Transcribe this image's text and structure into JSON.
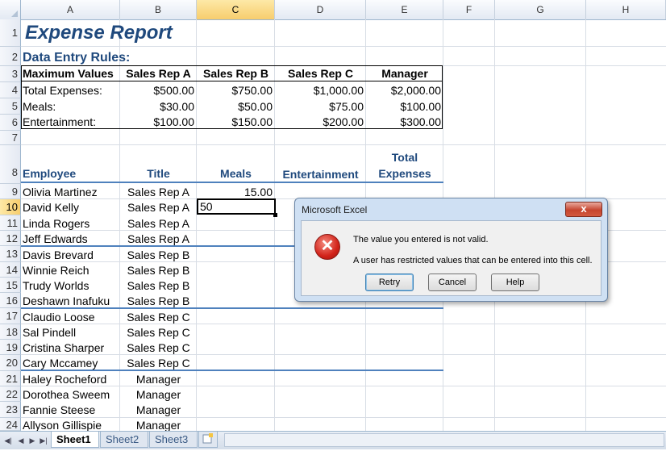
{
  "columns": [
    "A",
    "B",
    "C",
    "D",
    "E",
    "F",
    "G",
    "H"
  ],
  "active_cell": {
    "col": "C",
    "row": "10"
  },
  "rows": [
    "1",
    "2",
    "3",
    "4",
    "5",
    "6",
    "7",
    "8",
    "9",
    "10",
    "11",
    "12",
    "13",
    "14",
    "15",
    "16",
    "17",
    "18",
    "19",
    "20",
    "21",
    "22",
    "23",
    "24"
  ],
  "sheet": {
    "title": "Expense Report",
    "rules_heading": "Data Entry Rules:",
    "rules_headers": [
      "Maximum Values",
      "Sales Rep A",
      "Sales Rep B",
      "Sales Rep C",
      "Manager"
    ],
    "rules_rows": [
      {
        "label": "Total Expenses:",
        "values": [
          "$500.00",
          "$750.00",
          "$1,000.00",
          "$2,000.00"
        ]
      },
      {
        "label": "Meals:",
        "values": [
          "$30.00",
          "$50.00",
          "$75.00",
          "$100.00"
        ]
      },
      {
        "label": "Entertainment:",
        "values": [
          "$100.00",
          "$150.00",
          "$200.00",
          "$300.00"
        ]
      }
    ],
    "table_headers": {
      "employee": "Employee",
      "title": "Title",
      "meals": "Meals",
      "entertainment": "Entertainment",
      "total_line1": "Total",
      "total_line2": "Expenses"
    },
    "employees": [
      {
        "name": "Olivia Martinez",
        "title": "Sales Rep A",
        "meals": "15.00"
      },
      {
        "name": "David Kelly",
        "title": "Sales Rep A",
        "meals": "50"
      },
      {
        "name": "Linda Rogers",
        "title": "Sales Rep A",
        "meals": ""
      },
      {
        "name": "Jeff Edwards",
        "title": "Sales Rep A",
        "meals": ""
      },
      {
        "name": "Davis Brevard",
        "title": "Sales Rep B",
        "meals": ""
      },
      {
        "name": "Winnie Reich",
        "title": "Sales Rep B",
        "meals": ""
      },
      {
        "name": "Trudy Worlds",
        "title": "Sales Rep B",
        "meals": ""
      },
      {
        "name": "Deshawn Inafuku",
        "title": "Sales Rep B",
        "meals": ""
      },
      {
        "name": "Claudio Loose",
        "title": "Sales Rep C",
        "meals": ""
      },
      {
        "name": "Sal Pindell",
        "title": "Sales Rep C",
        "meals": ""
      },
      {
        "name": "Cristina Sharper",
        "title": "Sales Rep C",
        "meals": ""
      },
      {
        "name": "Cary Mccamey",
        "title": "Sales Rep C",
        "meals": ""
      },
      {
        "name": "Haley Rocheford",
        "title": "Manager",
        "meals": ""
      },
      {
        "name": "Dorothea Sweem",
        "title": "Manager",
        "meals": ""
      },
      {
        "name": "Fannie Steese",
        "title": "Manager",
        "meals": ""
      },
      {
        "name": "Allyson Gillispie",
        "title": "Manager",
        "meals": ""
      }
    ]
  },
  "tabs": [
    "Sheet1",
    "Sheet2",
    "Sheet3"
  ],
  "dialog": {
    "title": "Microsoft Excel",
    "close_label": "x",
    "icon": "error-icon",
    "icon_glyph": "✕",
    "message1": "The value you entered is not valid.",
    "message2": "A user has restricted values that can be entered into this cell.",
    "buttons": {
      "retry": "Retry",
      "cancel": "Cancel",
      "help": "Help"
    }
  }
}
